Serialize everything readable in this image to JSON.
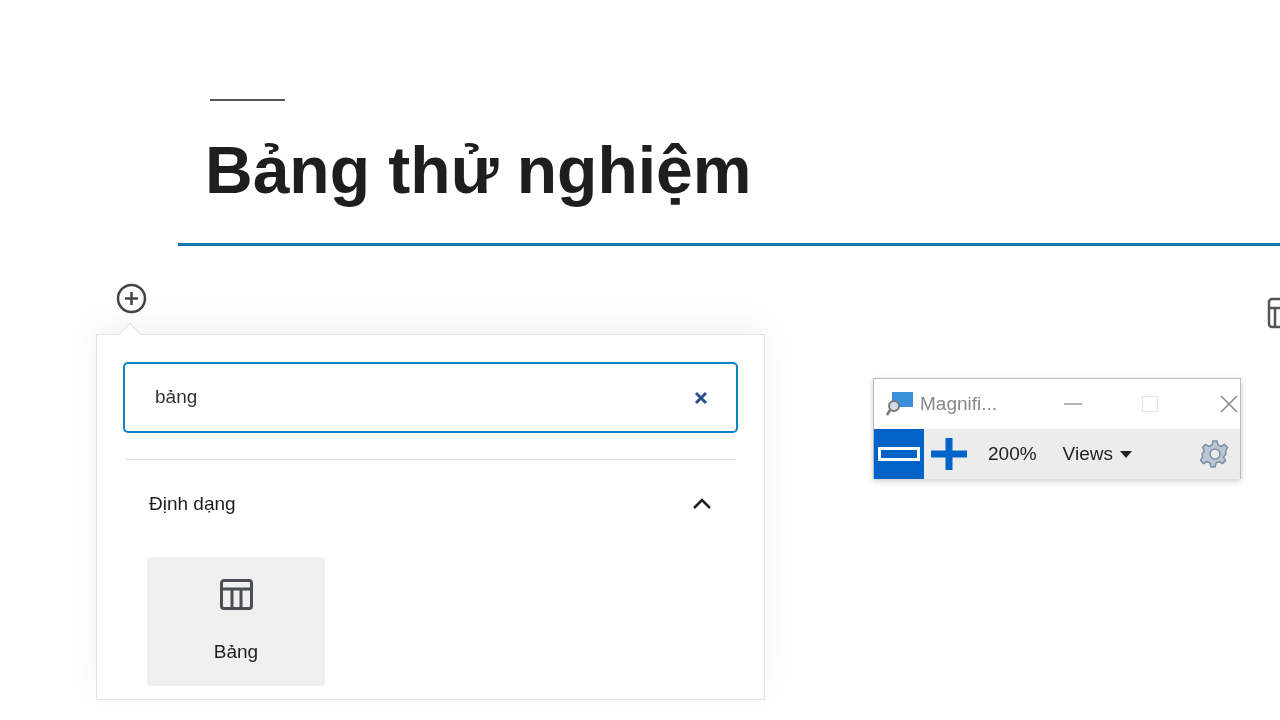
{
  "title": "Bảng thử nghiệm",
  "inserter": {
    "search": {
      "value": "bảng"
    },
    "sections": [
      {
        "title": "Định dạng",
        "expanded": true,
        "blocks": [
          {
            "label": "Bảng",
            "selected": true
          }
        ]
      }
    ]
  },
  "magnifier": {
    "title": "Magnifi...",
    "zoom": "200%",
    "views": "Views"
  }
}
